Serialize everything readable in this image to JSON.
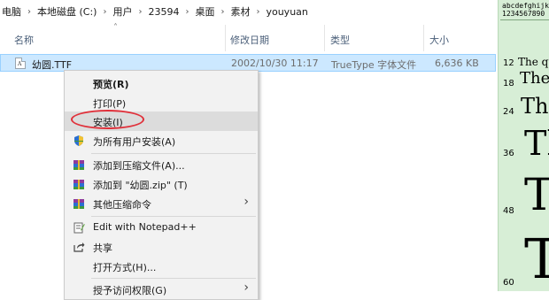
{
  "breadcrumb": [
    "电脑",
    "本地磁盘 (C:)",
    "用户",
    "23594",
    "桌面",
    "素材",
    "youyuan"
  ],
  "columns": {
    "name": "名称",
    "date": "修改日期",
    "type": "类型",
    "size": "大小"
  },
  "file": {
    "name": "幼圆.TTF",
    "date": "2002/10/30 11:17",
    "type": "TrueType 字体文件",
    "size": "6,636 KB",
    "icon": "font-file-icon"
  },
  "menu": {
    "preview": "预览(R)",
    "print": "打印(P)",
    "install": "安装(I)",
    "install_all": "为所有用户安装(A)",
    "add_archive": "添加到压缩文件(A)...",
    "add_zip": "添加到 \"幼圆.zip\" (T)",
    "other_compress": "其他压缩命令",
    "notepad": "Edit with Notepad++",
    "share": "共享",
    "open_with": "打开方式(H)...",
    "grant_access": "授予访问权限(G)"
  },
  "font_preview": {
    "alphabet_line1": "abcdefghijklmnopqrstuvwxyz",
    "alphabet_line2": "1234567890",
    "sizes": [
      "12",
      "18",
      "24",
      "36",
      "48",
      "60"
    ],
    "samples": [
      "The quick",
      "The quick",
      "The",
      "Th",
      "Th",
      "Th"
    ]
  },
  "colors": {
    "selection": "#cce8ff",
    "preview_bg": "#d7eed6",
    "highlight_circle": "#e0303a"
  }
}
